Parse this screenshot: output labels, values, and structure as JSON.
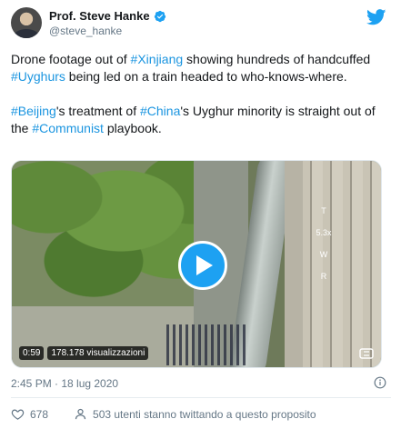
{
  "author": {
    "name": "Prof. Steve Hanke",
    "handle": "@steve_hanke",
    "verified": true,
    "avatar_icon": "profile-photo"
  },
  "brand_icon": "twitter-bird-icon",
  "tweet": {
    "paragraph1": [
      {
        "text": "Drone footage out of ",
        "tag": false
      },
      {
        "text": "#Xinjiang",
        "tag": true
      },
      {
        "text": " showing hundreds of handcuffed ",
        "tag": false
      },
      {
        "text": "#Uyghurs",
        "tag": true
      },
      {
        "text": " being led on a train headed to who-knows-where.",
        "tag": false
      }
    ],
    "paragraph2": [
      {
        "text": "#Beijing",
        "tag": true
      },
      {
        "text": "'s treatment of ",
        "tag": false
      },
      {
        "text": "#China",
        "tag": true
      },
      {
        "text": "'s Uyghur minority is straight out of the ",
        "tag": false
      },
      {
        "text": "#Communist",
        "tag": true
      },
      {
        "text": " playbook.",
        "tag": false
      }
    ]
  },
  "media": {
    "duration": "0:59",
    "views": "178.178 visualizzazioni",
    "overlay_letters": [
      "T",
      "5.3x",
      "W",
      "R"
    ],
    "play_icon": "play-icon"
  },
  "footer": {
    "timestamp": "2:45 PM · 18 lug 2020",
    "likes": "678",
    "discussion": "503 utenti stanno twittando a questo proposito"
  },
  "colors": {
    "link": "#1b95e0",
    "brand": "#1da1f2",
    "muted": "#657786",
    "like": "#e0245e"
  }
}
